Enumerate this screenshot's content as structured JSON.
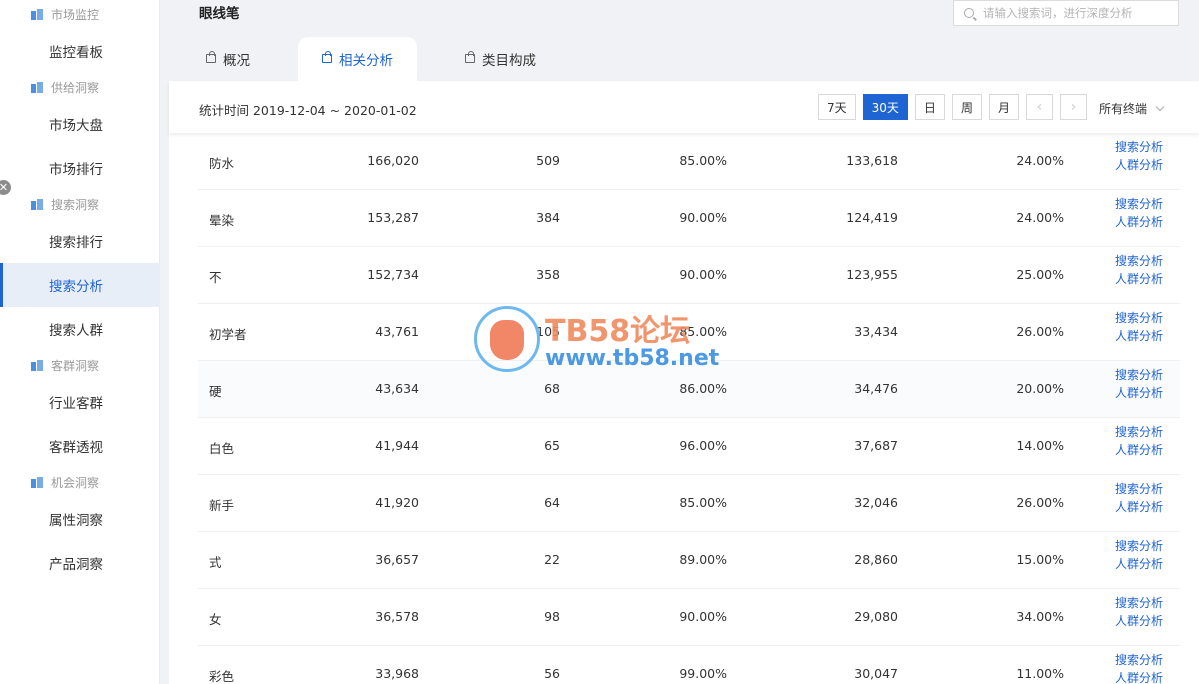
{
  "sidebar": {
    "groups": [
      {
        "label": "市场监控",
        "items": [
          "监控看板"
        ]
      },
      {
        "label": "供给洞察",
        "items": [
          "市场大盘",
          "市场排行"
        ]
      },
      {
        "label": "搜索洞察",
        "items": [
          "搜索排行",
          "搜索分析",
          "搜索人群"
        ]
      },
      {
        "label": "客群洞察",
        "items": [
          "行业客群",
          "客群透视"
        ]
      },
      {
        "label": "机会洞察",
        "items": [
          "属性洞察",
          "产品洞察"
        ]
      }
    ],
    "close_glyph": "✕"
  },
  "header": {
    "title": "眼线笔",
    "search_placeholder": "请输入搜索词，进行深度分析"
  },
  "tabs": [
    "概况",
    "相关分析",
    "类目构成"
  ],
  "toolbar": {
    "stat_time": "统计时间 2019-12-04 ~ 2020-01-02",
    "ranges": [
      "7天",
      "30天",
      "日",
      "周",
      "月"
    ],
    "prev": "‹",
    "next": "›",
    "terminal": "所有终端"
  },
  "table": {
    "rows": [
      {
        "word": "防水",
        "c1": "166,020",
        "c2": "509",
        "c3": "85.00%",
        "c4": "133,618",
        "c5": "24.00%"
      },
      {
        "word": "晕染",
        "c1": "153,287",
        "c2": "384",
        "c3": "90.00%",
        "c4": "124,419",
        "c5": "24.00%"
      },
      {
        "word": "不",
        "c1": "152,734",
        "c2": "358",
        "c3": "90.00%",
        "c4": "123,955",
        "c5": "25.00%"
      },
      {
        "word": "初学者",
        "c1": "43,761",
        "c2": "105",
        "c3": "85.00%",
        "c4": "33,434",
        "c5": "26.00%"
      },
      {
        "word": "硬",
        "c1": "43,634",
        "c2": "68",
        "c3": "86.00%",
        "c4": "34,476",
        "c5": "20.00%"
      },
      {
        "word": "白色",
        "c1": "41,944",
        "c2": "65",
        "c3": "96.00%",
        "c4": "37,687",
        "c5": "14.00%"
      },
      {
        "word": "新手",
        "c1": "41,920",
        "c2": "64",
        "c3": "85.00%",
        "c4": "32,046",
        "c5": "26.00%"
      },
      {
        "word": "式",
        "c1": "36,657",
        "c2": "22",
        "c3": "89.00%",
        "c4": "28,860",
        "c5": "15.00%"
      },
      {
        "word": "女",
        "c1": "36,578",
        "c2": "98",
        "c3": "90.00%",
        "c4": "29,080",
        "c5": "34.00%"
      },
      {
        "word": "彩色",
        "c1": "33,968",
        "c2": "56",
        "c3": "99.00%",
        "c4": "30,047",
        "c5": "11.00%"
      }
    ],
    "link_search": "搜索分析",
    "link_crowd": "人群分析"
  },
  "watermark": {
    "line1": "TB58论坛",
    "line2": "www.tb58.net"
  }
}
